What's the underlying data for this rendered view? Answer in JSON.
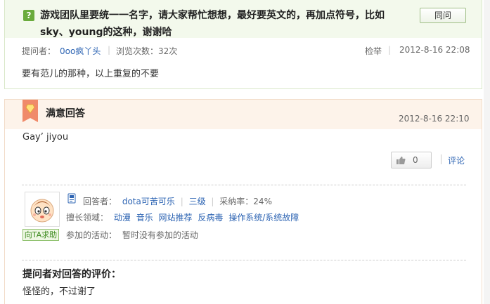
{
  "question": {
    "icon": "question-icon",
    "title": "游戏团队里要统一一名字，请大家帮忙想想，最好要英文的，再加点符号，比如sky、young的这种，谢谢哈",
    "same_button": "同问",
    "asker_label": "提问者：",
    "asker_name": "0oo疯丫头",
    "views_label": "浏览次数：32次",
    "report": "检举",
    "time": "2012-8-16 22:08",
    "body": "要有范儿的那种，以上重复的不要"
  },
  "answer": {
    "badge_icon": "ribbon-badge-icon",
    "title": "满意回答",
    "time": "2012-8-16 22:10",
    "body": "Gay’ jiyou",
    "vote_count": "0",
    "comment": "评论",
    "help_button": "向TA求助",
    "answerer_label": "回答者：",
    "answerer_name": "dota可苦可乐",
    "level": "三级",
    "adopt_rate": "采纳率：24%",
    "skills_label": "擅长领域：",
    "skills": [
      "动漫",
      "音乐",
      "网站推荐",
      "反病毒",
      "操作系统/系统故障"
    ],
    "activity_label": "参加的活动：",
    "activity_value": "暂时没有参加的活动",
    "eval_title": "提问者对回答的评价：",
    "eval_body": "怪怪的，不过谢了"
  },
  "colors": {
    "link": "#2d64b3",
    "question_header_bg": "#f3f9ec",
    "answer_header_bg": "#fdf3ea",
    "accent_green": "#6aab3c",
    "ribbon": "#f08a6a"
  }
}
